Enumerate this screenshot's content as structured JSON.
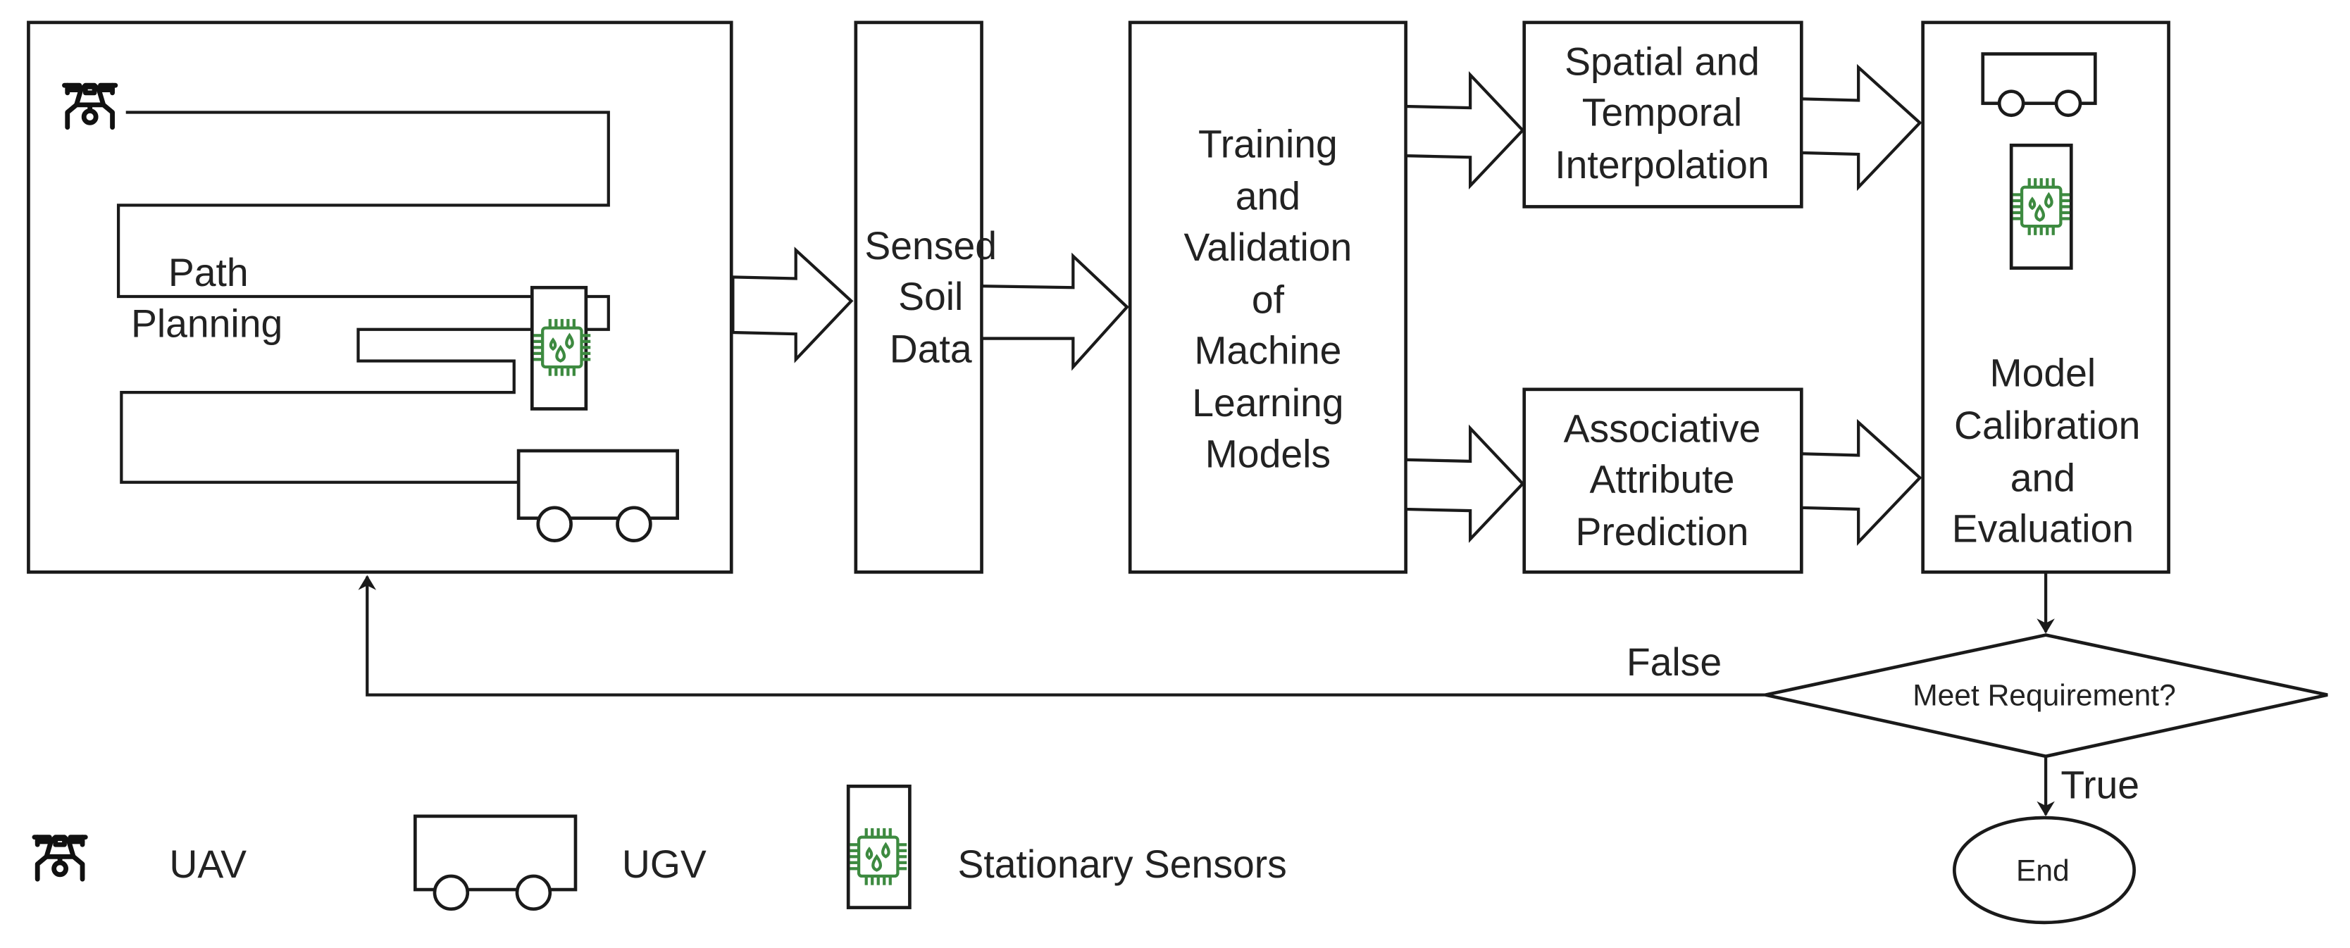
{
  "diagram": {
    "path_planning": {
      "line1": "Path",
      "line2": "Planning"
    },
    "sensed_soil_data": {
      "lines": [
        "Sensed",
        "Soil",
        "Data"
      ]
    },
    "training": {
      "lines": [
        "Training",
        "and",
        "Validation",
        "of",
        "Machine",
        "Learning",
        "Models"
      ]
    },
    "spatial": {
      "lines": [
        "Spatial and",
        "Temporal",
        "Interpolation"
      ]
    },
    "associative": {
      "lines": [
        "Associative",
        "Attribute",
        "Prediction"
      ]
    },
    "calibration": {
      "lines": [
        "Model",
        "Calibration",
        "and",
        "Evaluation"
      ]
    },
    "decision": {
      "label": "Meet Requirement?",
      "false_label": "False",
      "true_label": "True"
    },
    "end": {
      "label": "End"
    }
  },
  "legend": {
    "items": [
      {
        "icon": "drone-icon",
        "label": "UAV"
      },
      {
        "icon": "ugv-icon",
        "label": "UGV"
      },
      {
        "icon": "soil-sensor-icon",
        "label": "Stationary Sensors"
      }
    ]
  },
  "colors": {
    "stroke": "#1a1a1a",
    "sensor_green": "#3d8a40",
    "background": "#ffffff"
  }
}
